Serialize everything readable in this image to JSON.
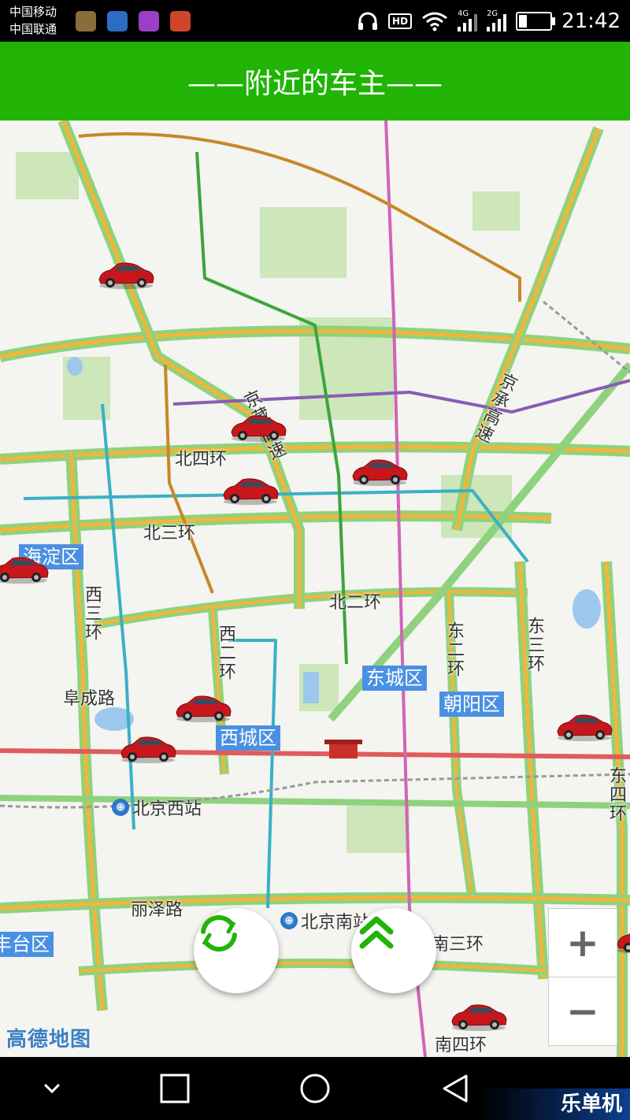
{
  "status_bar": {
    "carrier_1": "中国移动",
    "carrier_2": "中国联通",
    "hd_label": "HD",
    "net_4g": "4G",
    "net_2g": "2G",
    "time": "21:42"
  },
  "header": {
    "title": "——附近的车主——"
  },
  "map": {
    "districts": [
      "海淀区",
      "东城区",
      "朝阳区",
      "西城区",
      "丰台区"
    ],
    "roads": [
      "北四环",
      "北三环",
      "北二环",
      "京藏高速",
      "京承高速",
      "西三环",
      "西二环",
      "东二环",
      "东三环",
      "东四环",
      "阜成路",
      "丽泽路",
      "南三环",
      "南四环"
    ],
    "stations": [
      "北京西站",
      "北京南站"
    ],
    "watermark": "高德地图"
  },
  "controls": {
    "refresh_icon": "refresh-icon",
    "expand_icon": "double-chevron-up-icon",
    "zoom_in": "+",
    "zoom_out": "−"
  },
  "brand": "乐单机",
  "colors": {
    "accent": "#21b407",
    "district": "#4a90e2"
  }
}
